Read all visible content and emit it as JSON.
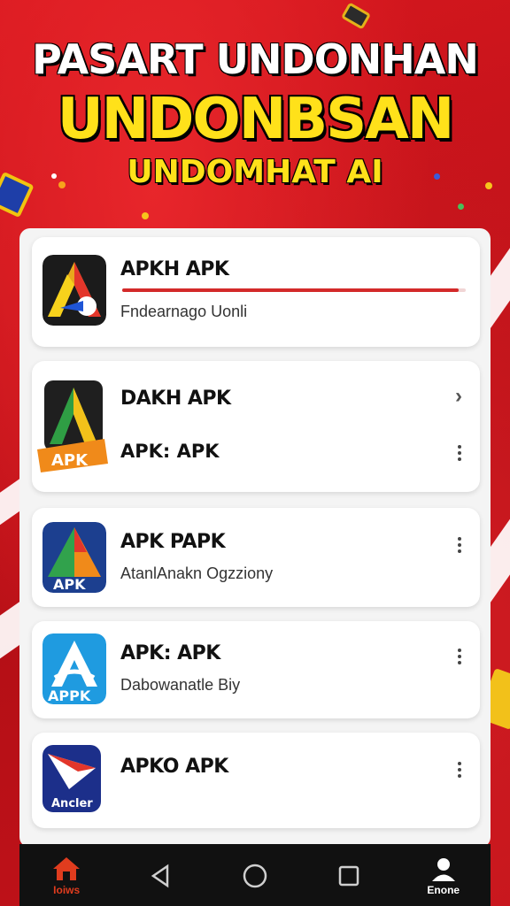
{
  "headline": {
    "line1": "PASART UNDONHAN",
    "line2": "UNDONBSAN",
    "line3": "UNDOMHAT AI"
  },
  "apps": [
    {
      "title": "APKH APK",
      "subtitle": "Fndearnago Uonli",
      "progress": 0.98,
      "icon": "apk-a-icon-dark"
    },
    {
      "title": "DAKH APK",
      "subtitle": "APK: APK",
      "icon": "apk-a-icon-badge",
      "badge": "APK"
    },
    {
      "title": "APK PAPK",
      "subtitle": "AtanlAnakn Ogzziony",
      "icon": "apk-a-icon-blue",
      "badge": "APK"
    },
    {
      "title": "APK: APK",
      "subtitle": "Dabowanatle Biy",
      "icon": "apk-a-icon-light",
      "badge": "APPK"
    },
    {
      "title": "APKO APK",
      "subtitle": "",
      "icon": "apk-arrow-icon",
      "badge": "Ancler"
    }
  ],
  "nav": {
    "home_label": "Ioiws",
    "profile_label": "Enone"
  },
  "colors": {
    "background": "#c8141b",
    "accent_yellow": "#ffe11a",
    "progress": "#d32a2a",
    "nav_active": "#e03c1e"
  }
}
